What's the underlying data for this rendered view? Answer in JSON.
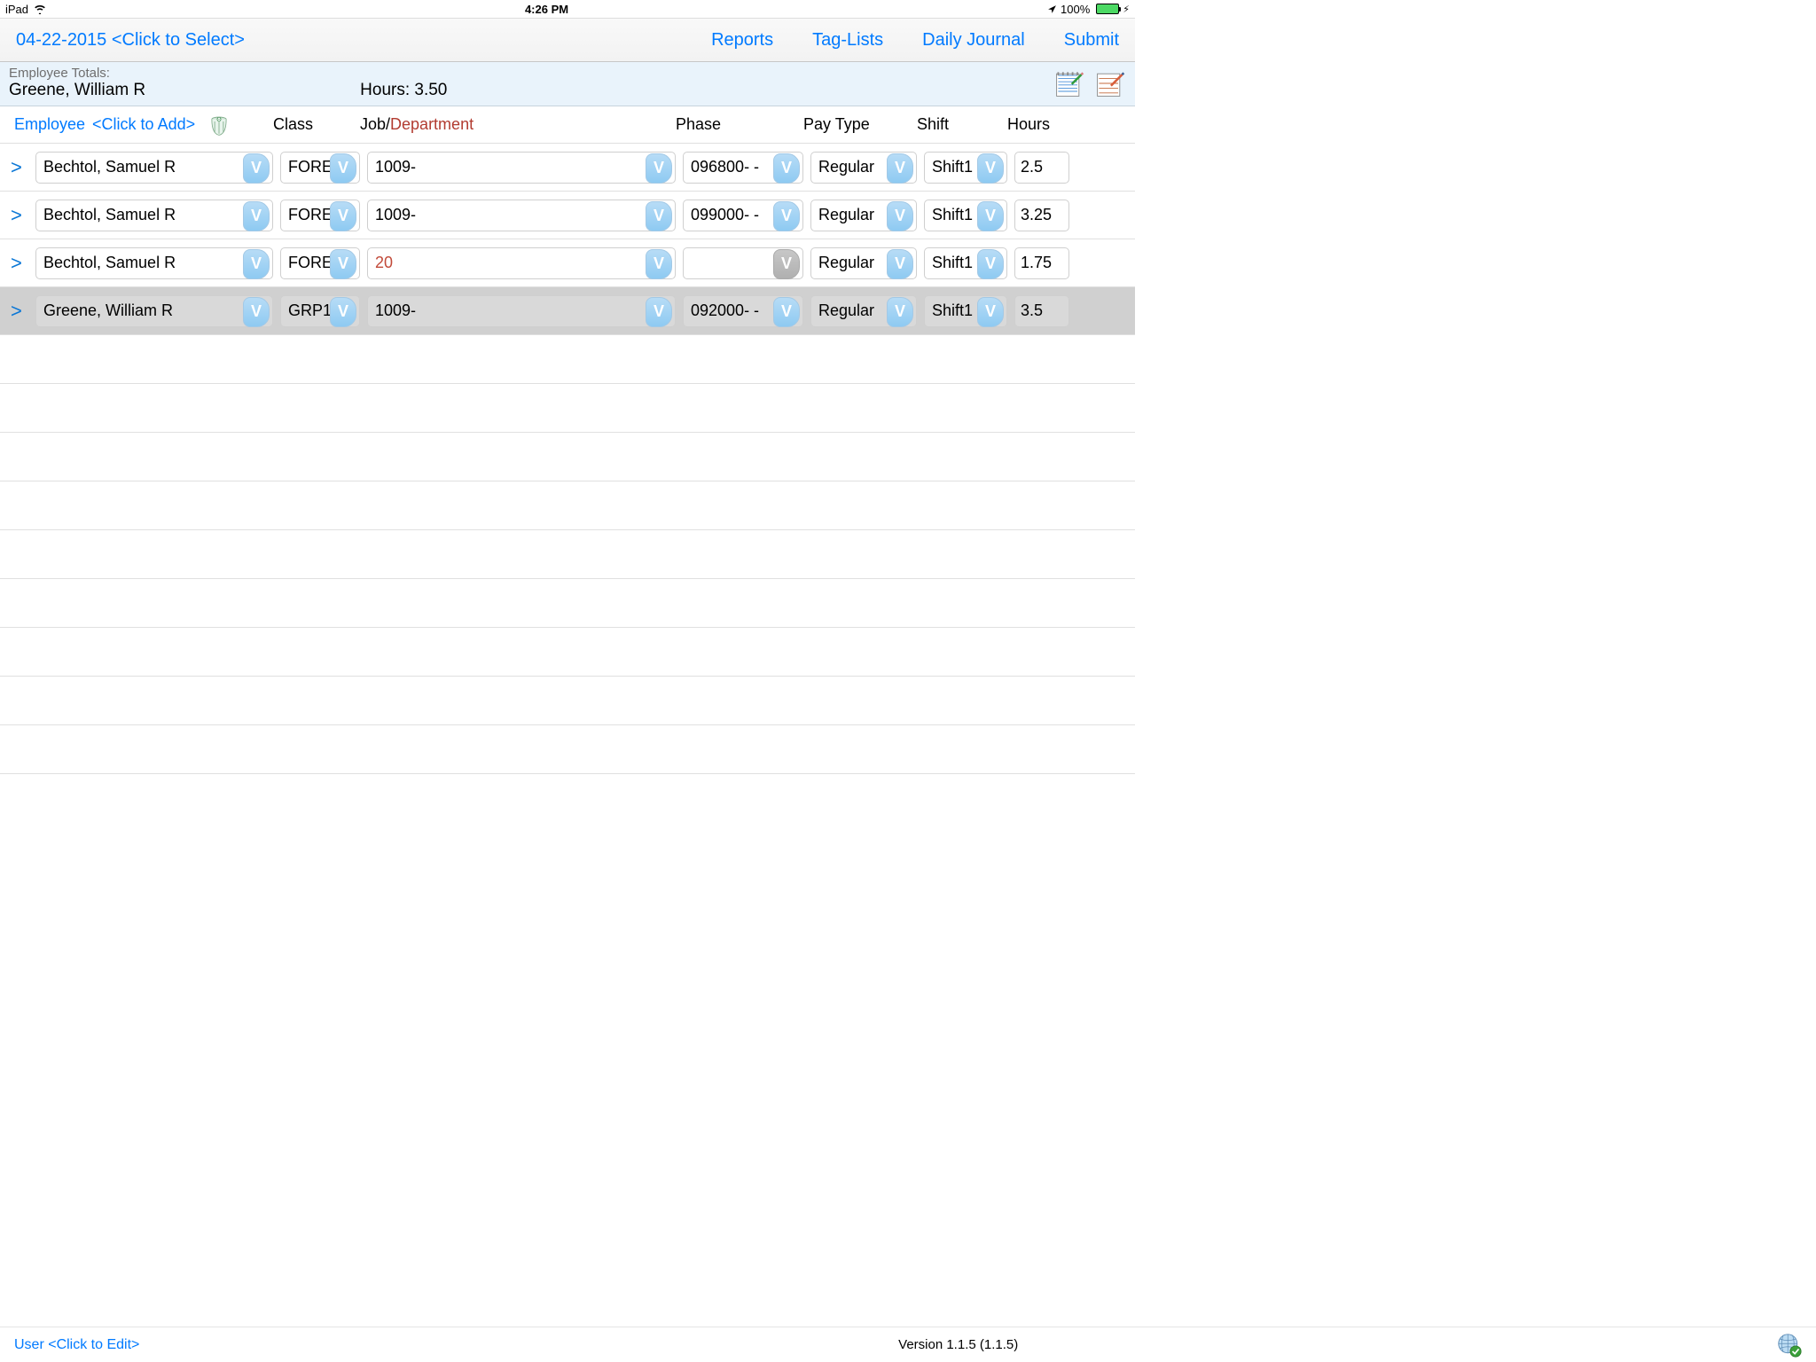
{
  "statusbar": {
    "device": "iPad",
    "time": "4:26 PM",
    "battery": "100%"
  },
  "toolbar": {
    "date_selector": "04-22-2015 <Click to Select>",
    "links": {
      "reports": "Reports",
      "taglists": "Tag-Lists",
      "daily_journal": "Daily Journal",
      "submit": "Submit"
    }
  },
  "totals": {
    "label": "Employee Totals:",
    "name": "Greene, William R",
    "hours_label": "Hours: 3.50"
  },
  "columns": {
    "employee_label": "Employee",
    "employee_add": "<Click to Add>",
    "class": "Class",
    "job": "Job/",
    "department": "Department",
    "phase": "Phase",
    "pay_type": "Pay Type",
    "shift": "Shift",
    "hours": "Hours"
  },
  "rows": [
    {
      "employee": "Bechtol, Samuel R",
      "class": "FORE",
      "job": "1009-",
      "job_red": false,
      "phase": "096800-  -",
      "phase_disabled": false,
      "pay": "Regular",
      "shift": "Shift1",
      "hours": "2.5",
      "selected": false
    },
    {
      "employee": "Bechtol, Samuel R",
      "class": "FORE",
      "job": "1009-",
      "job_red": false,
      "phase": "099000-  -",
      "phase_disabled": false,
      "pay": "Regular",
      "shift": "Shift1",
      "hours": "3.25",
      "selected": false
    },
    {
      "employee": "Bechtol, Samuel R",
      "class": "FORE",
      "job": "20",
      "job_red": true,
      "phase": "",
      "phase_disabled": true,
      "pay": "Regular",
      "shift": "Shift1",
      "hours": "1.75",
      "selected": false
    },
    {
      "employee": "Greene, William R",
      "class": "GRP1",
      "job": "1009-",
      "job_red": false,
      "phase": "092000-  -",
      "phase_disabled": false,
      "pay": "Regular",
      "shift": "Shift1",
      "hours": "3.5",
      "selected": true
    }
  ],
  "footer": {
    "user_edit": "User <Click to Edit>",
    "version": "Version 1.1.5 (1.1.5)"
  },
  "glyph": {
    "arrow": ">",
    "v": "V"
  }
}
